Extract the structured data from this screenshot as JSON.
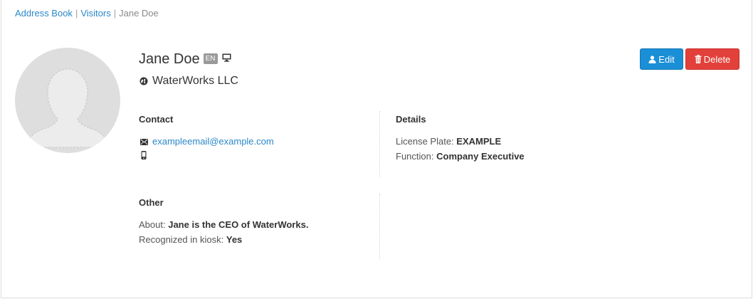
{
  "breadcrumb": {
    "items": [
      {
        "label": "Address Book"
      },
      {
        "label": "Visitors"
      }
    ],
    "separator": "|",
    "current": "Jane Doe"
  },
  "profile": {
    "name": "Jane Doe",
    "language_badge": "EN",
    "company": "WaterWorks LLC"
  },
  "actions": {
    "edit_label": "Edit",
    "delete_label": "Delete"
  },
  "contact": {
    "title": "Contact",
    "email": "exampleemail@example.com",
    "phone": ""
  },
  "details": {
    "title": "Details",
    "license_plate_label": "License Plate:",
    "license_plate": "EXAMPLE",
    "function_label": "Function:",
    "function": "Company Executive"
  },
  "other": {
    "title": "Other",
    "about_label": "About:",
    "about": "Jane is the CEO of WaterWorks.",
    "kiosk_label": "Recognized in kiosk:",
    "kiosk": "Yes"
  },
  "colors": {
    "link": "#2a88c8",
    "edit_button": "#1a8fd6",
    "delete_button": "#e2413b",
    "badge": "#9a9a9a",
    "avatar_bg": "#dedede"
  },
  "icons": {
    "language": "en-badge",
    "device": "desktop-icon",
    "company": "globe-icon",
    "edit": "user-icon",
    "delete": "trash-icon",
    "email": "envelope-icon",
    "phone": "mobile-phone-icon"
  }
}
